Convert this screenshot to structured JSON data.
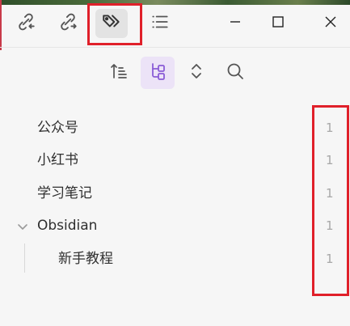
{
  "toolbar": {
    "tabs": [
      {
        "name": "backlinks",
        "icon": "link-in-icon",
        "active": false
      },
      {
        "name": "outgoing-links",
        "icon": "link-out-icon",
        "active": false
      },
      {
        "name": "tags",
        "icon": "tags-icon",
        "active": true
      },
      {
        "name": "outline",
        "icon": "list-icon",
        "active": false
      }
    ],
    "window_controls": [
      "minimize-icon",
      "maximize-icon",
      "close-icon"
    ]
  },
  "subbar": {
    "buttons": [
      {
        "name": "sort",
        "icon": "sort-ascending-icon",
        "active": false
      },
      {
        "name": "nested-tags",
        "icon": "tag-tree-icon",
        "active": true
      },
      {
        "name": "collapse-all",
        "icon": "chevrons-up-down-icon",
        "active": false
      },
      {
        "name": "search",
        "icon": "search-icon",
        "active": false
      }
    ],
    "accent": "#8a5cd6"
  },
  "tags": [
    {
      "label": "公众号",
      "count": "1"
    },
    {
      "label": "小红书",
      "count": "1"
    },
    {
      "label": "学习笔记",
      "count": "1"
    },
    {
      "label": "Obsidian",
      "count": "1",
      "expanded": true
    },
    {
      "label": "新手教程",
      "count": "1",
      "child": true
    }
  ],
  "highlight_color": "#e0202a"
}
